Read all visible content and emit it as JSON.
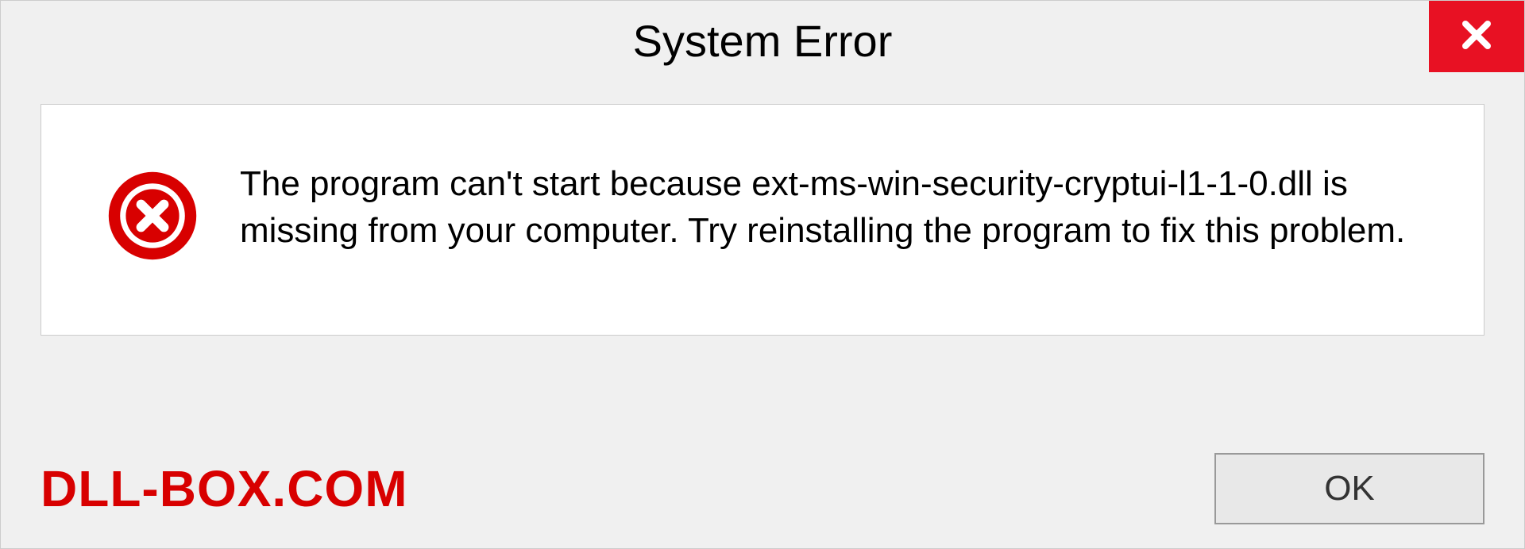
{
  "title": "System Error",
  "message": "The program can't start because ext-ms-win-security-cryptui-l1-1-0.dll is missing from your computer. Try reinstalling the program to fix this problem.",
  "ok_label": "OK",
  "watermark": "DLL-BOX.COM",
  "colors": {
    "close_bg": "#e81123",
    "watermark": "#d80000",
    "error_icon": "#d80000"
  }
}
